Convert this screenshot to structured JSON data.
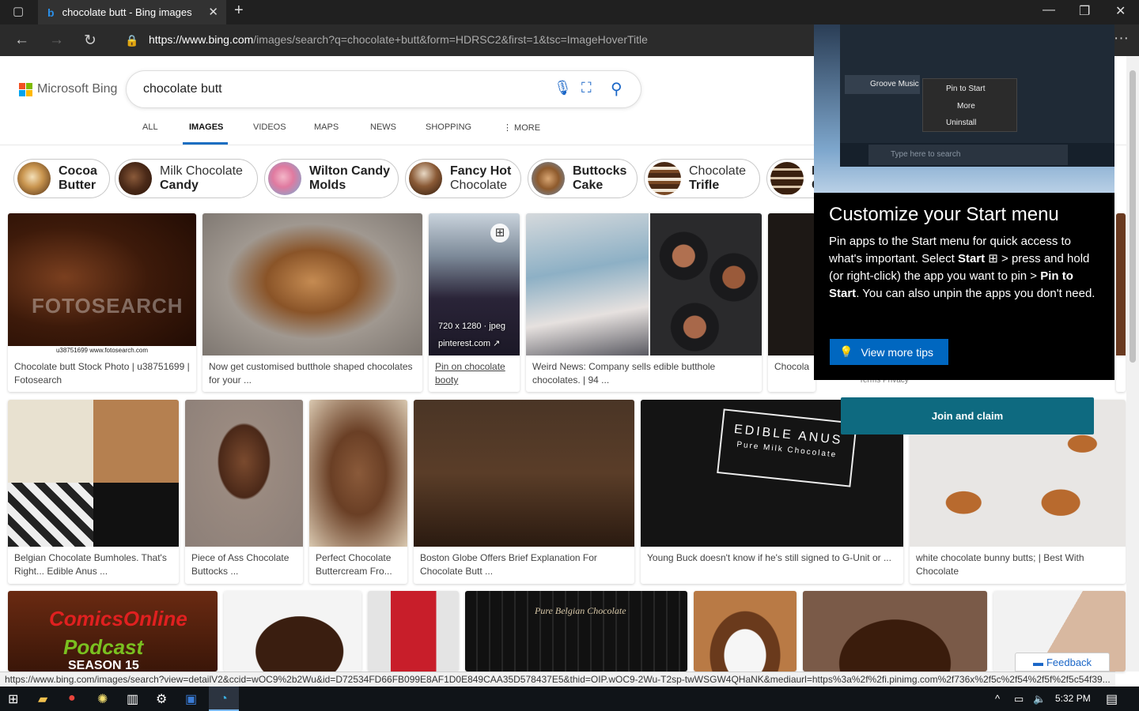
{
  "browser": {
    "tab_title": "chocolate butt - Bing images",
    "url_host": "https://www.bing.com",
    "url_rest": "/images/search?q=chocolate+butt&form=HDRSC2&first=1&tsc=ImageHoverTitle",
    "new_tab": "+",
    "close_tab": "✕"
  },
  "header": {
    "logo_text": "Microsoft Bing",
    "query": "chocolate butt",
    "tabs": [
      "ALL",
      "IMAGES",
      "VIDEOS",
      "MAPS",
      "NEWS",
      "SHOPPING",
      "⋮ MORE"
    ]
  },
  "pills": [
    {
      "line1": "Cocoa",
      "line2": "Butter",
      "bold": "both"
    },
    {
      "line1": "Milk Chocolate",
      "line2": "Candy",
      "bold": "line2"
    },
    {
      "line1": "Wilton Candy",
      "line2": "Molds",
      "bold": "both"
    },
    {
      "line1": "Fancy Hot",
      "line2": "Chocolate",
      "bold": "line1"
    },
    {
      "line1": "Buttocks",
      "line2": "Cake",
      "bold": "both"
    },
    {
      "line1": "Chocolate",
      "line2": "Trifle",
      "bold": "line2"
    },
    {
      "line1": "L",
      "line2": "C",
      "bold": "both"
    }
  ],
  "row1": [
    {
      "caption": "Chocolate butt Stock Photo | u38751699 | Fotosearch",
      "watermark": "FOTOSEARCH",
      "sub": "u38751699 www.fotosearch.com"
    },
    {
      "caption": "Now get customised butthole shaped chocolates for your ..."
    },
    {
      "caption": "Pin on chocolate booty",
      "meta_size": "720 x 1280 · jpeg",
      "meta_src": "pinterest.com ↗"
    },
    {
      "caption": "Weird News: Company sells edible butthole chocolates. | 94 ..."
    },
    {
      "caption": "Chocolat"
    }
  ],
  "row2": [
    {
      "caption": "Belgian Chocolate Bumholes. That's Right... Edible Anus ..."
    },
    {
      "caption": "Piece of Ass Chocolate Buttocks ..."
    },
    {
      "caption": "Perfect Chocolate Buttercream Fro..."
    },
    {
      "caption": "Boston Globe Offers Brief Explanation For Chocolate Butt ..."
    },
    {
      "caption": "Young Buck doesn't know if he's still signed to G-Unit or ...",
      "sign_title": "EDIBLE ANUS",
      "sign_sub": "Pure Milk Chocolate"
    },
    {
      "caption": "white chocolate bunny butts; | Best With Chocolate"
    }
  ],
  "row3": [
    {
      "caption": "",
      "text1": "ComicsOnline",
      "text2": "Podcast",
      "text3": "SEASON 15"
    },
    {
      "caption": ""
    },
    {
      "caption": ""
    },
    {
      "caption": "",
      "text1": "Pure Belgian Chocolate"
    },
    {
      "caption": ""
    },
    {
      "caption": ""
    },
    {
      "caption": ""
    }
  ],
  "tip": {
    "title": "Customize your Start menu",
    "body_pre": "Pin apps to the Start menu for quick access to what's important. Select ",
    "body_start": "Start",
    "body_mid": " > press and hold (or right-click) the app you want to pin > ",
    "body_pin": "Pin to Start",
    "body_post": ". You can also unpin the apps you don't need.",
    "button": "View more tips",
    "menu_app": "Groove Music",
    "menu_items": [
      "Pin to Start",
      "More",
      "Uninstall"
    ],
    "search_hint": "Type here to search"
  },
  "join_button": "Join and claim",
  "terms": "Terms   Privacy",
  "feedback": "Feedback",
  "status_url": "https://www.bing.com/images/search?view=detailV2&ccid=wOC9%2b2Wu&id=D72534FD66FB099E8AF1D0E849CAA35D578437E5&thid=OIP.wOC9-2Wu-T2sp-twWSGW4QHaNK&mediaurl=https%3a%2f%2fi.pinimg.com%2f736x%2f5c%2f54%2f5f%2f5c54f39...",
  "taskbar": {
    "time": "5:32 PM"
  }
}
